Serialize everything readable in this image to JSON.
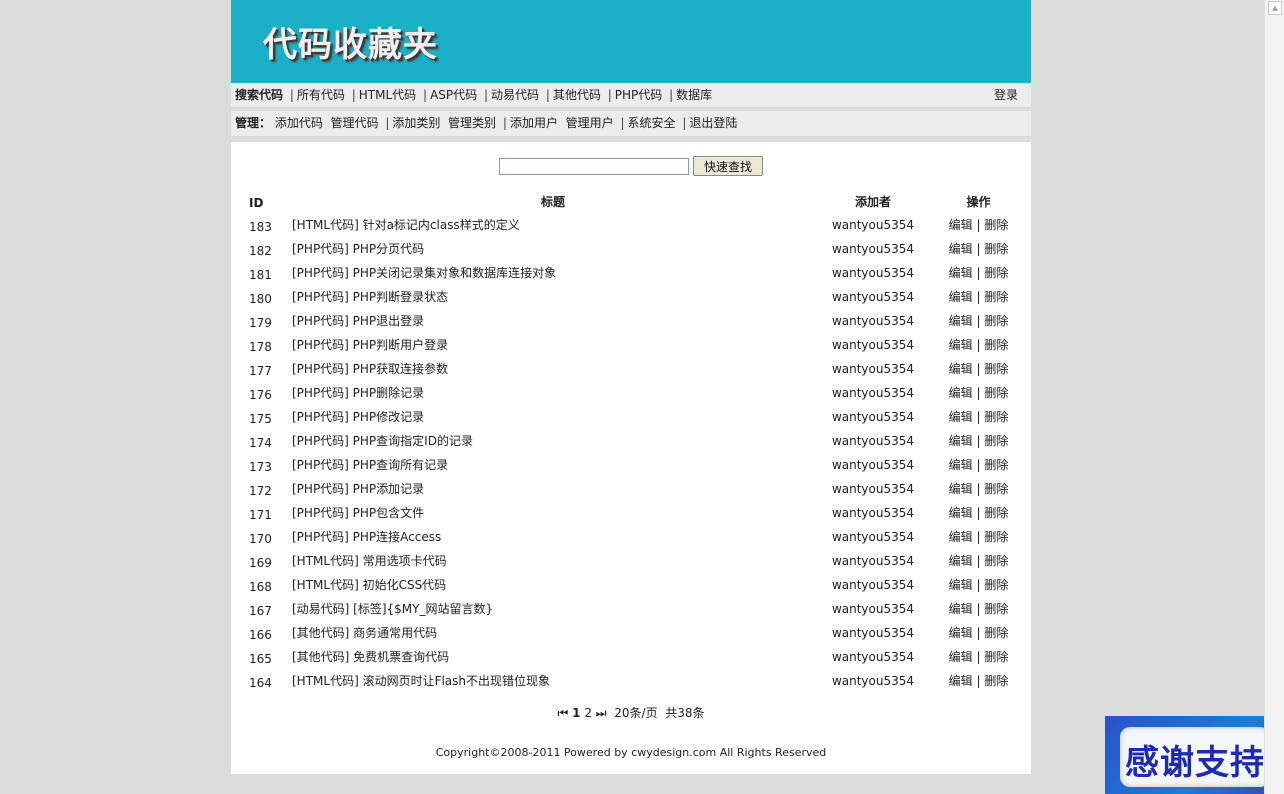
{
  "site": {
    "logo_text": "代码收藏夹"
  },
  "nav": {
    "label": "搜索代码",
    "items": [
      "所有代码",
      "HTML代码",
      "ASP代码",
      "动易代码",
      "其他代码",
      "PHP代码",
      "数据库"
    ],
    "login": "登录"
  },
  "admin": {
    "label": "管理：",
    "items": [
      "添加代码",
      "管理代码",
      "添加类别",
      "管理类别",
      "添加用户",
      "管理用户",
      "系统安全",
      "退出登陆"
    ]
  },
  "search": {
    "value": "",
    "button_label": "快速查找"
  },
  "table": {
    "headers": {
      "id": "ID",
      "title": "标题",
      "adder": "添加者",
      "ops": "操作"
    },
    "edit_label": "编辑",
    "delete_label": "删除",
    "rows": [
      {
        "id": "183",
        "title": "[HTML代码] 针对a标记内class样式的定义",
        "adder": "wantyou5354"
      },
      {
        "id": "182",
        "title": "[PHP代码] PHP分页代码",
        "adder": "wantyou5354"
      },
      {
        "id": "181",
        "title": "[PHP代码] PHP关闭记录集对象和数据库连接对象",
        "adder": "wantyou5354"
      },
      {
        "id": "180",
        "title": "[PHP代码] PHP判断登录状态",
        "adder": "wantyou5354"
      },
      {
        "id": "179",
        "title": "[PHP代码] PHP退出登录",
        "adder": "wantyou5354"
      },
      {
        "id": "178",
        "title": "[PHP代码] PHP判断用户登录",
        "adder": "wantyou5354"
      },
      {
        "id": "177",
        "title": "[PHP代码] PHP获取连接参数",
        "adder": "wantyou5354"
      },
      {
        "id": "176",
        "title": "[PHP代码] PHP删除记录",
        "adder": "wantyou5354"
      },
      {
        "id": "175",
        "title": "[PHP代码] PHP修改记录",
        "adder": "wantyou5354"
      },
      {
        "id": "174",
        "title": "[PHP代码] PHP查询指定ID的记录",
        "adder": "wantyou5354"
      },
      {
        "id": "173",
        "title": "[PHP代码] PHP查询所有记录",
        "adder": "wantyou5354"
      },
      {
        "id": "172",
        "title": "[PHP代码] PHP添加记录",
        "adder": "wantyou5354"
      },
      {
        "id": "171",
        "title": "[PHP代码] PHP包含文件",
        "adder": "wantyou5354"
      },
      {
        "id": "170",
        "title": "[PHP代码] PHP连接Access",
        "adder": "wantyou5354"
      },
      {
        "id": "169",
        "title": "[HTML代码] 常用选项卡代码",
        "adder": "wantyou5354"
      },
      {
        "id": "168",
        "title": "[HTML代码] 初始化CSS代码",
        "adder": "wantyou5354"
      },
      {
        "id": "167",
        "title": "[动易代码] [标签]{$MY_网站留言数}",
        "adder": "wantyou5354"
      },
      {
        "id": "166",
        "title": "[其他代码] 商务通常用代码",
        "adder": "wantyou5354"
      },
      {
        "id": "165",
        "title": "[其他代码] 免费机票查询代码",
        "adder": "wantyou5354"
      },
      {
        "id": "164",
        "title": "[HTML代码] 滚动网页时让Flash不出现错位现象",
        "adder": "wantyou5354"
      }
    ]
  },
  "pager": {
    "first_glyph": "⏮",
    "pages": [
      "1",
      "2"
    ],
    "last_glyph": "⏭",
    "per_page": "20条/页",
    "total": "共38条"
  },
  "footer": {
    "copyright": "Copyright©2008-2011 Powered by cwydesign.com All Rights Reserved"
  },
  "support": {
    "text": "感谢支持"
  },
  "scroll": {
    "arrow_glyph": "▲"
  }
}
